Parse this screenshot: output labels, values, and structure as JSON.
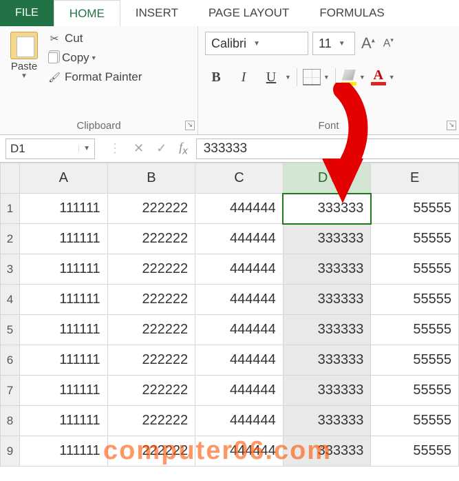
{
  "tabs": [
    "FILE",
    "HOME",
    "INSERT",
    "PAGE LAYOUT",
    "FORMULAS"
  ],
  "active_tab": "HOME",
  "clipboard": {
    "paste": "Paste",
    "cut": "Cut",
    "copy": "Copy",
    "painter": "Format Painter",
    "group_title": "Clipboard"
  },
  "font": {
    "name": "Calibri",
    "size": "11",
    "bold": "B",
    "italic": "I",
    "underline": "U",
    "group_title": "Font"
  },
  "name_box": "D1",
  "formula_value": "333333",
  "columns": [
    "A",
    "B",
    "C",
    "D",
    "E"
  ],
  "selected_column": "D",
  "rows": [
    {
      "n": "1",
      "cells": [
        "111111",
        "222222",
        "444444",
        "333333",
        "55555"
      ]
    },
    {
      "n": "2",
      "cells": [
        "111111",
        "222222",
        "444444",
        "333333",
        "55555"
      ]
    },
    {
      "n": "3",
      "cells": [
        "111111",
        "222222",
        "444444",
        "333333",
        "55555"
      ]
    },
    {
      "n": "4",
      "cells": [
        "111111",
        "222222",
        "444444",
        "333333",
        "55555"
      ]
    },
    {
      "n": "5",
      "cells": [
        "111111",
        "222222",
        "444444",
        "333333",
        "55555"
      ]
    },
    {
      "n": "6",
      "cells": [
        "111111",
        "222222",
        "444444",
        "333333",
        "55555"
      ]
    },
    {
      "n": "7",
      "cells": [
        "111111",
        "222222",
        "444444",
        "333333",
        "55555"
      ]
    },
    {
      "n": "8",
      "cells": [
        "111111",
        "222222",
        "444444",
        "333333",
        "55555"
      ]
    },
    {
      "n": "9",
      "cells": [
        "111111",
        "222222",
        "444444",
        "333333",
        "55555"
      ]
    }
  ],
  "watermark": "computer06.com"
}
